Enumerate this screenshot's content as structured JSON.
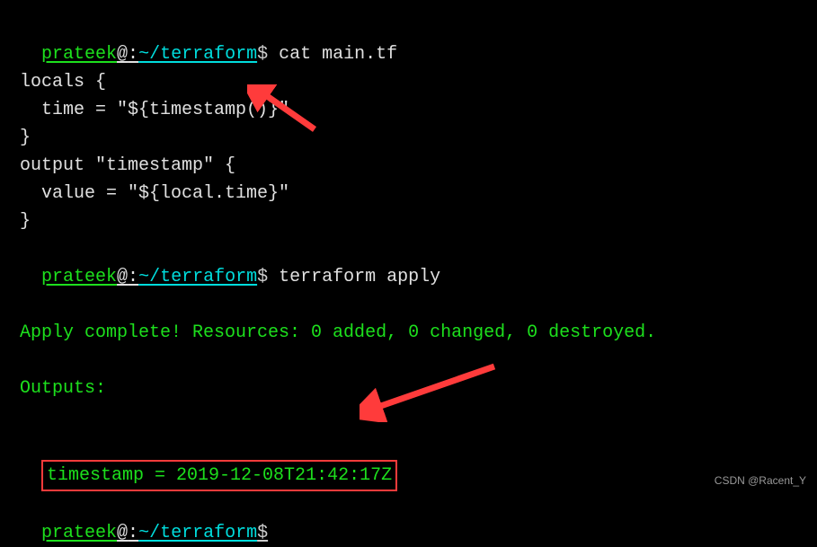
{
  "prompt": {
    "user": "prateek",
    "at": "@",
    "sep": ":",
    "path": "~/terraform",
    "dollar": "$"
  },
  "cmd1": "cat main.tf",
  "code": {
    "l1": "locals {",
    "l2": "  time = \"${timestamp()}\"",
    "l3": "}",
    "l4": "",
    "l5": "output \"timestamp\" {",
    "l6": "  value = \"${local.time}\"",
    "l7": "}"
  },
  "cmd2": "terraform apply",
  "result": {
    "complete": "Apply complete! Resources: 0 added, 0 changed, 0 destroyed.",
    "outputs_label": "Outputs:",
    "timestamp_line": "timestamp = 2019-12-08T21:42:17Z"
  },
  "watermark": "CSDN @Racent_Y"
}
